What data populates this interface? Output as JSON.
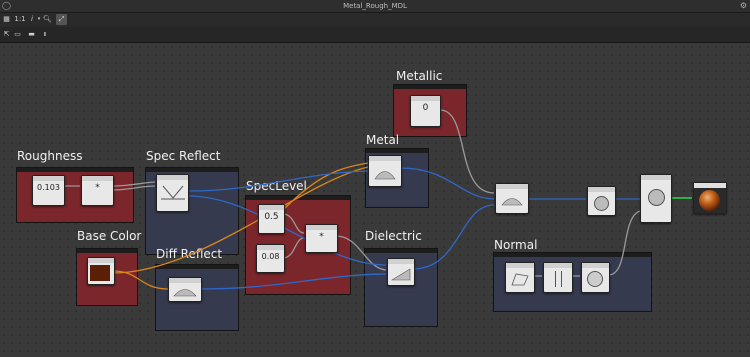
{
  "window": {
    "title": "Metal_Rough_MDL"
  },
  "toolbar": {
    "zoom_label": "1:1",
    "info_label": "i"
  },
  "groups": {
    "roughness": "Roughness",
    "spec_reflect": "Spec Reflect",
    "spec_level": "SpecLevel",
    "metallic": "Metallic",
    "metal": "Metal",
    "base_color": "Base Color",
    "diff_reflect": "Diff Reflect",
    "dielectric": "Dielectric",
    "normal": "Normal"
  },
  "nodes": {
    "roughness_value": "0.103",
    "metallic_value": "0",
    "speclevel_value": "0.5",
    "float_value": "0.08",
    "multiply_symbol": "*",
    "multiply2_symbol": "*"
  },
  "colors": {
    "wire_blue": "#2f68c8",
    "wire_orange": "#d9861c",
    "wire_gray": "#9a9a9a",
    "wire_green": "#2cc24a"
  }
}
